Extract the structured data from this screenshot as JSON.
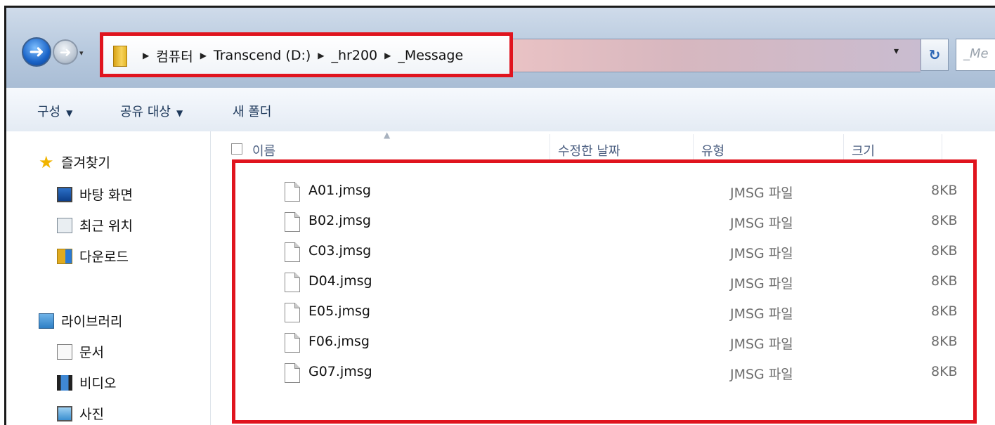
{
  "address_bar": {
    "breadcrumb": [
      "컴퓨터",
      "Transcend (D:)",
      "_hr200",
      "_Message"
    ],
    "search_placeholder": "_Me"
  },
  "toolbar": {
    "organize": "구성",
    "share_with": "공유 대상",
    "new_folder": "새 폴더"
  },
  "nav": {
    "favorites": {
      "label": "즐겨찾기",
      "items": [
        "바탕 화면",
        "최근 위치",
        "다운로드"
      ]
    },
    "libraries": {
      "label": "라이브러리",
      "items": [
        "문서",
        "비디오",
        "사진"
      ]
    }
  },
  "columns": {
    "name": "이름",
    "date_modified": "수정한 날짜",
    "type": "유형",
    "size": "크기"
  },
  "files": [
    {
      "name": "A01.jmsg",
      "type": "JMSG 파일",
      "size": "8KB"
    },
    {
      "name": "B02.jmsg",
      "type": "JMSG 파일",
      "size": "8KB"
    },
    {
      "name": "C03.jmsg",
      "type": "JMSG 파일",
      "size": "8KB"
    },
    {
      "name": "D04.jmsg",
      "type": "JMSG 파일",
      "size": "8KB"
    },
    {
      "name": "E05.jmsg",
      "type": "JMSG 파일",
      "size": "8KB"
    },
    {
      "name": "F06.jmsg",
      "type": "JMSG 파일",
      "size": "8KB"
    },
    {
      "name": "G07.jmsg",
      "type": "JMSG 파일",
      "size": "8KB"
    }
  ],
  "colors": {
    "highlight_border": "#e0141e",
    "toolbar_text": "#1e395b",
    "column_header_text": "#4d6082"
  },
  "icons": {
    "back": "back-arrow-icon",
    "forward": "forward-arrow-icon",
    "refresh": "refresh-icon",
    "favorites": "star-icon",
    "desktop": "desktop-icon",
    "recent": "recent-places-icon",
    "downloads": "downloads-icon",
    "libraries": "library-icon",
    "documents": "document-icon",
    "videos": "video-icon",
    "pictures": "picture-icon",
    "file": "file-icon"
  }
}
